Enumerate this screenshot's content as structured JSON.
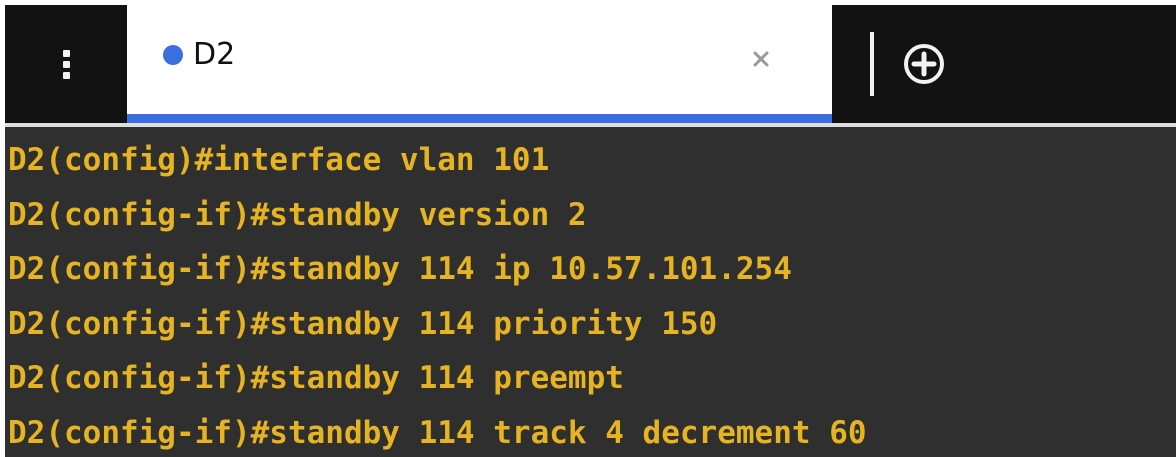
{
  "colors": {
    "tab_dot": "#3b6fe0",
    "tab_underline": "#3b6fe0",
    "terminal_text": "#e6b422",
    "terminal_bg": "#2f2f2f",
    "tabbar_bg": "#121212"
  },
  "tabbar": {
    "menu_icon": "vertical-dots-icon",
    "tabs": [
      {
        "label": "D2",
        "close_icon": "close-icon",
        "active": true
      }
    ],
    "new_tab_icon": "plus-circle-icon"
  },
  "terminal": {
    "lines": [
      "D2(config)#interface vlan 101",
      "D2(config-if)#standby version 2",
      "D2(config-if)#standby 114 ip 10.57.101.254",
      "D2(config-if)#standby 114 priority 150",
      "D2(config-if)#standby 114 preempt",
      "D2(config-if)#standby 114 track 4 decrement 60"
    ]
  }
}
